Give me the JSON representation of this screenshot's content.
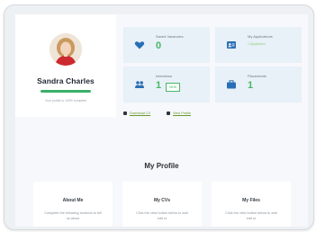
{
  "profile": {
    "name": "Sandra Charles",
    "completion_pct": 100,
    "completion_text": "Your profile is 100% complete"
  },
  "stats": {
    "saved_vacancies": {
      "label": "Saved Vacancies",
      "value": "0",
      "icon": "heart-icon"
    },
    "my_applications": {
      "label": "My Applications",
      "value": "0",
      "sub": "1 Application",
      "icon": "id-card-icon"
    },
    "interviews": {
      "label": "Interviews",
      "value": "1",
      "badge": "NEW",
      "icon": "people-icon"
    },
    "placements": {
      "label": "Placements",
      "value": "1",
      "icon": "briefcase-icon"
    }
  },
  "links": {
    "download_cv": "Download CV",
    "view_profile": "View Profile"
  },
  "section": {
    "title": "My Profile"
  },
  "tiles": [
    {
      "title": "About Me",
      "desc": "Complete the following sections to tell us about"
    },
    {
      "title": "My CVs",
      "desc": "Click the view button below to add edit or"
    },
    {
      "title": "My Files",
      "desc": "Click the view button below to add edit or"
    }
  ],
  "colors": {
    "accent_green": "#46b862",
    "icon_blue": "#2a6fb5",
    "stat_bg": "#e8f0f8"
  }
}
